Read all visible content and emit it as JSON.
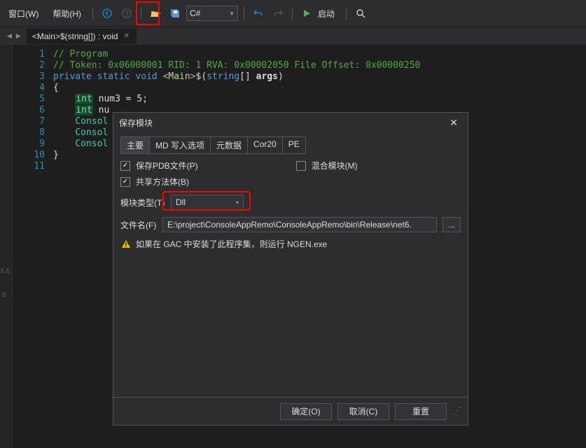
{
  "toolbar": {
    "window_menu": "窗口(W)",
    "help_menu": "帮助(H)",
    "language": "C#",
    "run_label": "启动"
  },
  "tab": {
    "title": "<Main>$(string[]) : void"
  },
  "code": {
    "line_numbers": [
      "1",
      "2",
      "3",
      "4",
      "5",
      "6",
      "7",
      "8",
      "9",
      "10",
      "11"
    ],
    "l1_comment": "// Program",
    "l2_comment": "// Token: 0x06000001 RID: 1 RVA: 0x00002050 File Offset: 0x00000250",
    "l3_private": "private",
    "l3_static": "static",
    "l3_void": "void",
    "l3_main": "Main",
    "l3_string": "string",
    "l3_args": "args",
    "l4_brace": "{",
    "l5_int": "int",
    "l5_rest": " num3 = 5;",
    "l6_int": "int",
    "l6_rest": " nu",
    "l7_console": "Consol",
    "l8_console": "Consol",
    "l9_console": "Consol",
    "l10_brace": "}"
  },
  "leftStrip": {
    "v1": "5.6",
    "v2": ".0"
  },
  "dialog": {
    "title": "保存模块",
    "tabs": {
      "main": "主要",
      "md_write": "MD 写入选项",
      "metadata": "元数据",
      "cor20": "Cor20",
      "pe": "PE"
    },
    "save_pdb_label": "保存PDB文件(P)",
    "mixed_module_label": "混合模块(M)",
    "share_method_label": "共享方法体(B)",
    "module_type_label": "模块类型(T)",
    "module_type_value": "Dll",
    "filename_label": "文件名(F)",
    "filename_value": "E:\\project\\ConsoleAppRemo\\ConsoleAppRemo\\bin\\Release\\net6.",
    "browse_label": "...",
    "warning_text": "如果在 GAC 中安装了此程序集，则运行 NGEN.exe",
    "ok_label": "确定(O)",
    "cancel_label": "取消(C)",
    "reset_label": "重置"
  }
}
